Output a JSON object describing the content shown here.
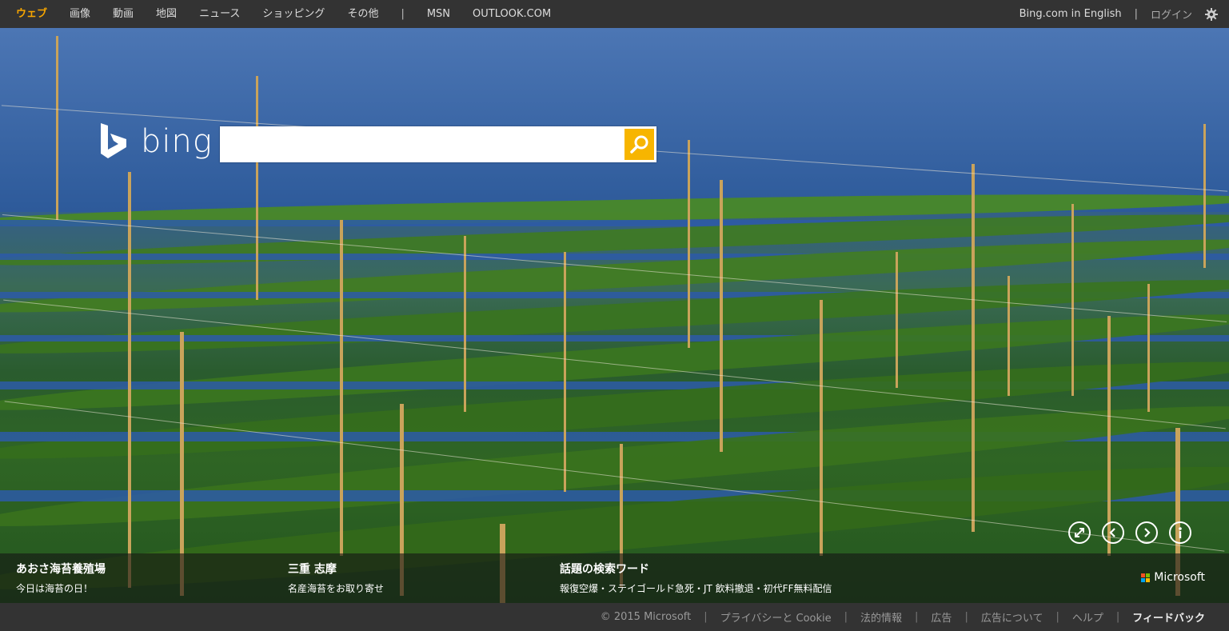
{
  "nav": {
    "items": [
      "ウェブ",
      "画像",
      "動画",
      "地図",
      "ニュース",
      "ショッピング",
      "その他"
    ],
    "separator": "|",
    "extra": [
      "MSN",
      "OUTLOOK.COM"
    ]
  },
  "top_right": {
    "english_link": "Bing.com in English",
    "separator": "|",
    "login": "ログイン"
  },
  "logo": {
    "text": "bing"
  },
  "search": {
    "value": "",
    "placeholder": ""
  },
  "captions": [
    {
      "title": "あおさ海苔養殖場",
      "subtitle": "今日は海苔の日！"
    },
    {
      "title": "三重 志摩",
      "subtitle": "名産海苔をお取り寄せ"
    },
    {
      "title": "話題の検索ワード",
      "subtitle": "報復空爆・ステイゴールド急死・JT 飲料撤退・初代FF無料配信"
    }
  ],
  "microsoft_label": "Microsoft",
  "footer": {
    "items": [
      "© 2015 Microsoft",
      "プライバシーと Cookie",
      "法的情報",
      "広告",
      "広告について",
      "ヘルプ",
      "フィードバック"
    ],
    "separator": "|"
  },
  "colors": {
    "accent": "#f7a600",
    "search_button": "#f7b500",
    "bar": "#333333"
  }
}
